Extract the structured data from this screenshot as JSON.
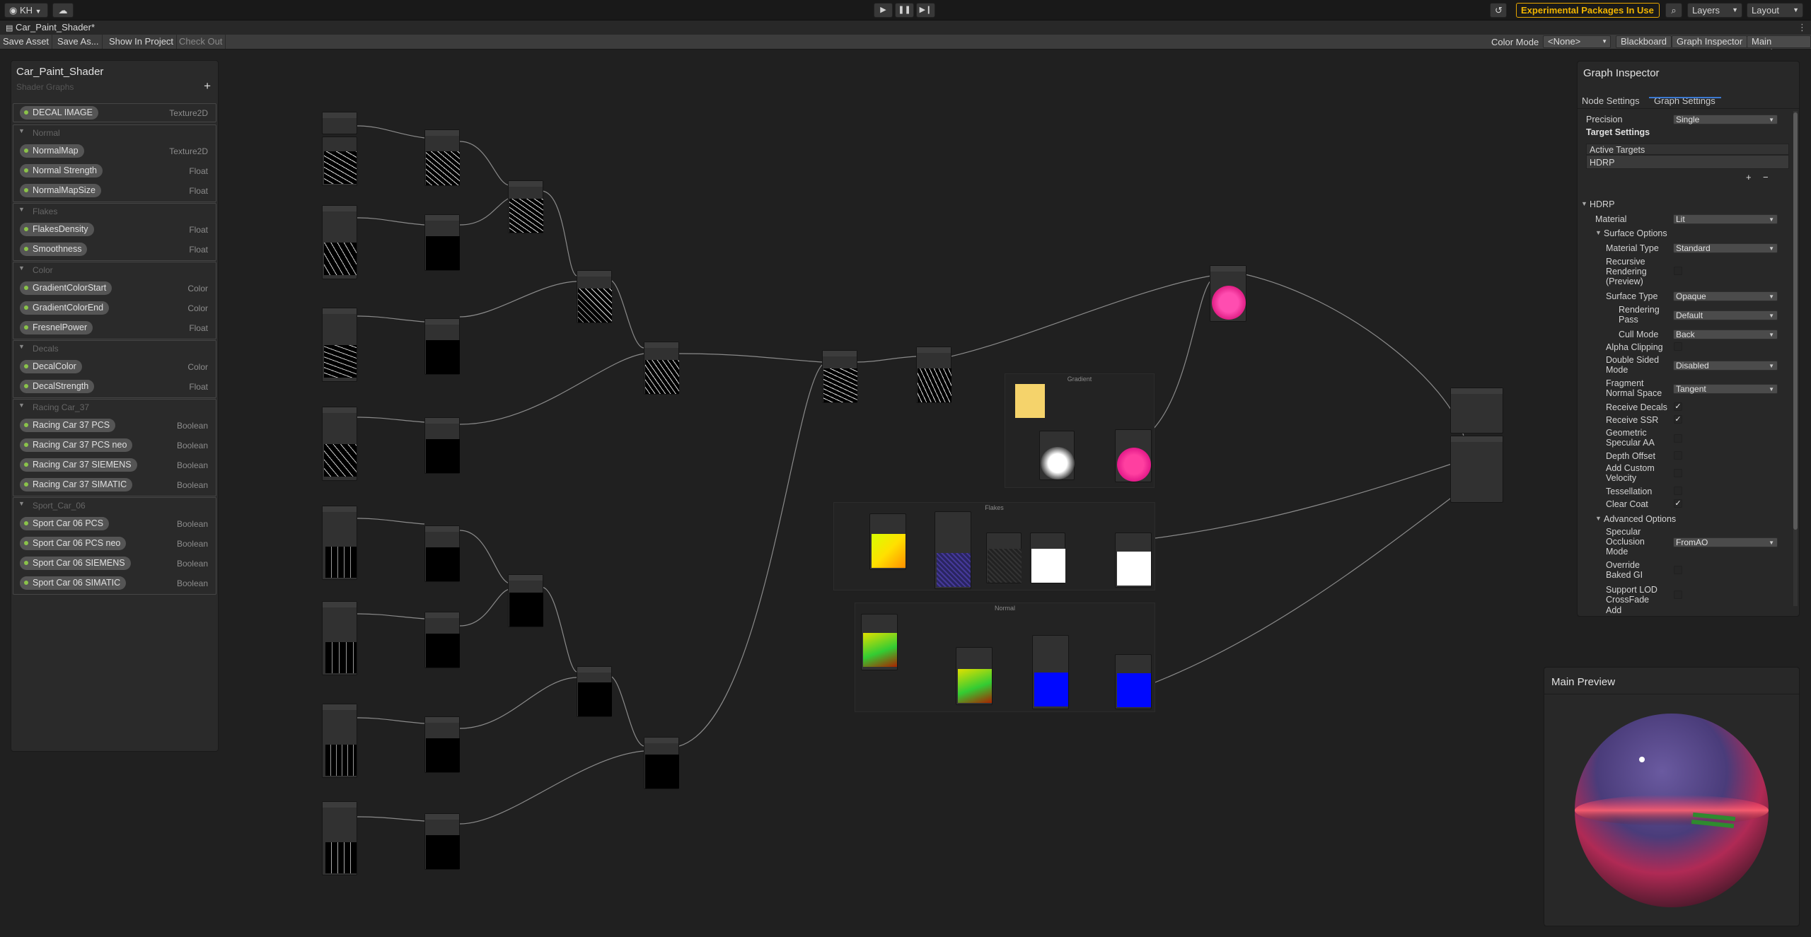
{
  "toolbar": {
    "account": "KH",
    "experimental": "Experimental Packages In Use",
    "layers": "Layers",
    "layout": "Layout"
  },
  "tab": {
    "title": "Car_Paint_Shader*"
  },
  "asset_toolbar": {
    "save_asset": "Save Asset",
    "save_as": "Save As...",
    "show_in_project": "Show In Project",
    "check_out": "Check Out",
    "color_mode_label": "Color Mode",
    "color_mode_value": "<None>",
    "blackboard": "Blackboard",
    "graph_inspector": "Graph Inspector",
    "main_preview": "Main Preview"
  },
  "blackboard": {
    "title": "Car_Paint_Shader",
    "subtitle": "Shader Graphs",
    "top_item": {
      "name": "DECAL IMAGE",
      "type": "Texture2D"
    },
    "categories": [
      {
        "name": "Normal",
        "items": [
          {
            "name": "NormalMap",
            "type": "Texture2D"
          },
          {
            "name": "Normal Strength",
            "type": "Float"
          },
          {
            "name": "NormalMapSize",
            "type": "Float"
          }
        ]
      },
      {
        "name": "Flakes",
        "items": [
          {
            "name": "FlakesDensity",
            "type": "Float"
          },
          {
            "name": "Smoothness",
            "type": "Float"
          }
        ]
      },
      {
        "name": "Color",
        "items": [
          {
            "name": "GradientColorStart",
            "type": "Color"
          },
          {
            "name": "GradientColorEnd",
            "type": "Color"
          },
          {
            "name": "FresnelPower",
            "type": "Float"
          }
        ]
      },
      {
        "name": "Decals",
        "items": [
          {
            "name": "DecalColor",
            "type": "Color"
          },
          {
            "name": "DecalStrength",
            "type": "Float"
          }
        ]
      },
      {
        "name": "Racing Car_37",
        "items": [
          {
            "name": "Racing Car 37 PCS",
            "type": "Boolean"
          },
          {
            "name": "Racing Car 37 PCS neo",
            "type": "Boolean"
          },
          {
            "name": "Racing Car 37 SIEMENS",
            "type": "Boolean"
          },
          {
            "name": "Racing Car 37 SIMATIC",
            "type": "Boolean"
          }
        ]
      },
      {
        "name": "Sport_Car_06",
        "items": [
          {
            "name": "Sport Car 06 PCS",
            "type": "Boolean"
          },
          {
            "name": "Sport Car 06 PCS neo",
            "type": "Boolean"
          },
          {
            "name": "Sport Car 06 SIEMENS",
            "type": "Boolean"
          },
          {
            "name": "Sport Car 06 SIMATIC",
            "type": "Boolean"
          }
        ]
      }
    ]
  },
  "groups": {
    "gradient": "Gradient",
    "flakes": "Flakes",
    "normal": "Normal"
  },
  "inspector": {
    "title": "Graph Inspector",
    "tab_node": "Node Settings",
    "tab_graph": "Graph Settings",
    "precision_label": "Precision",
    "precision_value": "Single",
    "target_settings": "Target Settings",
    "active_targets": "Active Targets",
    "target_item": "HDRP",
    "hdrp": "HDRP",
    "material_label": "Material",
    "material_value": "Lit",
    "surface_options": "Surface Options",
    "material_type_label": "Material Type",
    "material_type_value": "Standard",
    "recursive": "Recursive Rendering (Preview)",
    "surface_type_label": "Surface Type",
    "surface_type_value": "Opaque",
    "rendering_pass_label": "Rendering Pass",
    "rendering_pass_value": "Default",
    "cull_mode_label": "Cull Mode",
    "cull_mode_value": "Back",
    "alpha_clipping": "Alpha Clipping",
    "double_sided_label": "Double Sided Mode",
    "double_sided_value": "Disabled",
    "fragment_normal_label": "Fragment Normal Space",
    "fragment_normal_value": "Tangent",
    "receive_decals": "Receive Decals",
    "receive_ssr": "Receive SSR",
    "geometric_aa": "Geometric Specular AA",
    "depth_offset": "Depth Offset",
    "custom_velocity": "Add Custom Velocity",
    "tessellation": "Tessellation",
    "clear_coat": "Clear Coat",
    "advanced_options": "Advanced Options",
    "specular_occlusion_label": "Specular Occlusion Mode",
    "specular_occlusion_value": "FromAO",
    "override_baked": "Override Baked GI",
    "support_lod": "Support LOD CrossFade",
    "add": "Add",
    "check": "✓"
  },
  "preview": {
    "title": "Main Preview"
  },
  "colors": {
    "accent": "#f0b400",
    "magenta": "#ff1a8c",
    "blue": "#0008ff"
  }
}
